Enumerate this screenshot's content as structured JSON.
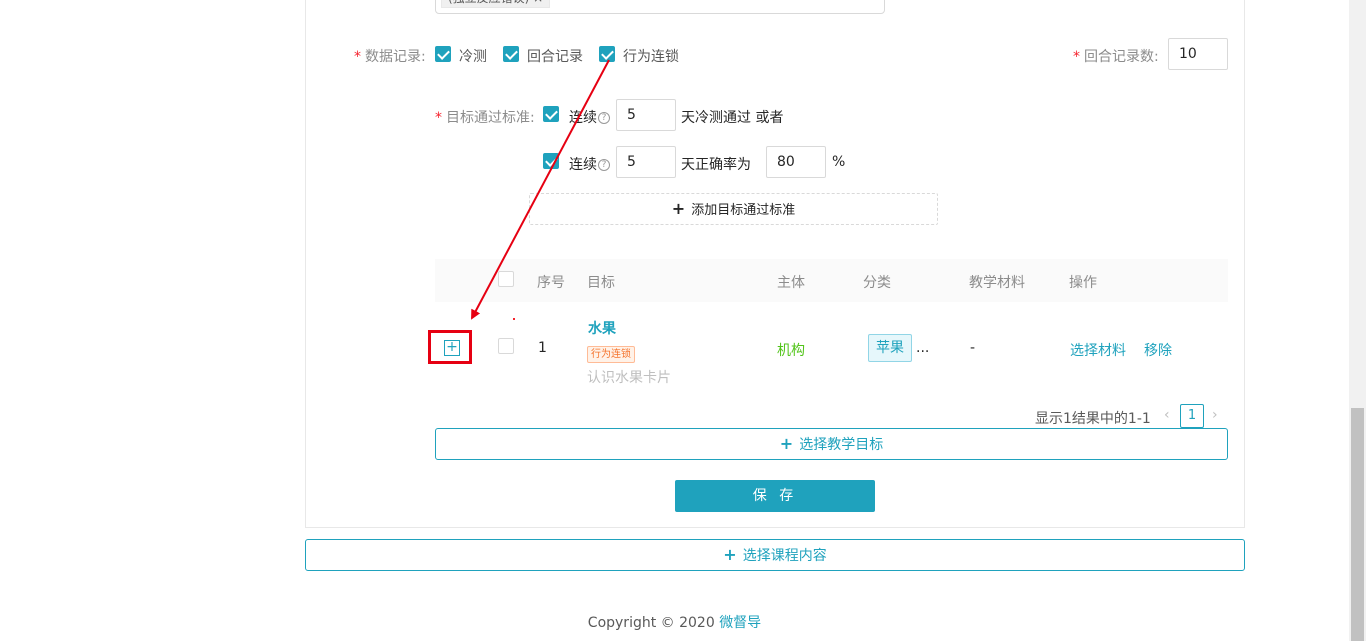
{
  "top": {
    "tag_text": "(独立反应错误) ×"
  },
  "data_record": {
    "label": "数据记录:",
    "options": [
      {
        "label": "冷测",
        "checked": true
      },
      {
        "label": "回合记录",
        "checked": true
      },
      {
        "label": "行为连锁",
        "checked": true
      }
    ],
    "rounds_label": "回合记录数:",
    "rounds_value": "10"
  },
  "target_standard": {
    "label": "目标通过标准:",
    "row1": {
      "prefix": "连续",
      "days": "5",
      "suffix": "天冷测通过 或者"
    },
    "row2": {
      "prefix": "连续",
      "days": "5",
      "middle": "天正确率为",
      "percent": "80",
      "unit": "%"
    },
    "add_label": "添加目标通过标准"
  },
  "table": {
    "headers": [
      "序号",
      "目标",
      "主体",
      "分类",
      "教学材料",
      "操作"
    ],
    "rows": [
      {
        "index": "1",
        "goal_title": "水果",
        "goal_tag": "行为连锁",
        "goal_desc": "认识水果卡片",
        "subject": "机构",
        "category": "苹果",
        "category_more": "...",
        "material": "-",
        "action_select": "选择材料",
        "action_remove": "移除"
      }
    ],
    "pagination_text": "显示1结果中的1-1",
    "current_page": "1"
  },
  "select_goal_label": "选择教学目标",
  "save_label": "保 存",
  "select_course_label": "选择课程内容",
  "footer": {
    "copyright": "Copyright © 2020",
    "brand": "微督导"
  },
  "colors": {
    "accent": "#1fa2bd",
    "required": "#f5222d",
    "annotation": "#e60012"
  }
}
